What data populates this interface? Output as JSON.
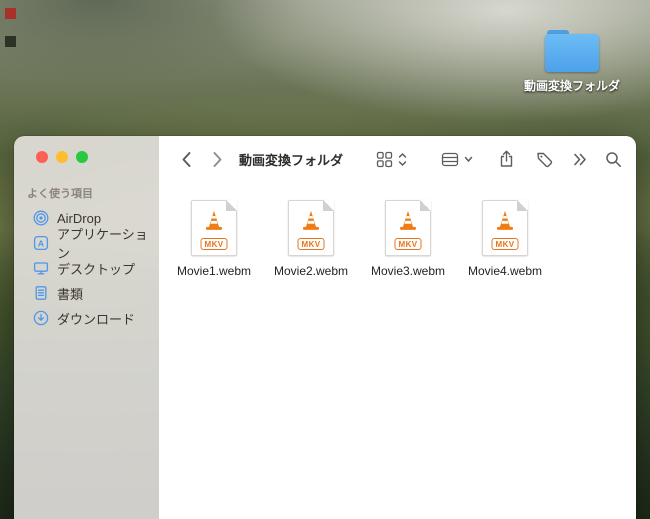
{
  "desktop": {
    "folder": {
      "label": "動画変換フォルダ",
      "icon": "folder-icon"
    }
  },
  "window": {
    "toolbar": {
      "title": "動画変換フォルダ",
      "back_icon": "chevron-left-icon",
      "forward_icon": "chevron-right-icon",
      "view_icon": "grid-view-icon",
      "view_sort_icon": "chevrons-up-down-icon",
      "group_icon": "group-view-icon",
      "group_chevron_icon": "chevron-down-icon",
      "share_icon": "share-icon",
      "tag_icon": "tag-icon",
      "more_icon": "double-chevron-right-icon",
      "search_icon": "search-icon"
    },
    "sidebar": {
      "section_label": "よく使う項目",
      "items": [
        {
          "label": "AirDrop",
          "icon": "airdrop-icon"
        },
        {
          "label": "アプリケーション",
          "icon": "applications-icon"
        },
        {
          "label": "デスクトップ",
          "icon": "desktop-icon"
        },
        {
          "label": "書類",
          "icon": "documents-icon"
        },
        {
          "label": "ダウンロード",
          "icon": "downloads-icon"
        }
      ],
      "window_controls": [
        "close",
        "minimize",
        "zoom"
      ]
    },
    "files": [
      {
        "name": "Movie1.webm",
        "type_badge": "MKV",
        "icon": "vlc-mkv-file-icon"
      },
      {
        "name": "Movie2.webm",
        "type_badge": "MKV",
        "icon": "vlc-mkv-file-icon"
      },
      {
        "name": "Movie3.webm",
        "type_badge": "MKV",
        "icon": "vlc-mkv-file-icon"
      },
      {
        "name": "Movie4.webm",
        "type_badge": "MKV",
        "icon": "vlc-mkv-file-icon"
      }
    ]
  },
  "colors": {
    "folder_blue": "#58aef2",
    "vlc_orange": "#e8731a",
    "sidebar_icon_blue": "#4e97ea",
    "traffic_red": "#ff5f57",
    "traffic_yellow": "#febc2e",
    "traffic_green": "#28c840"
  }
}
